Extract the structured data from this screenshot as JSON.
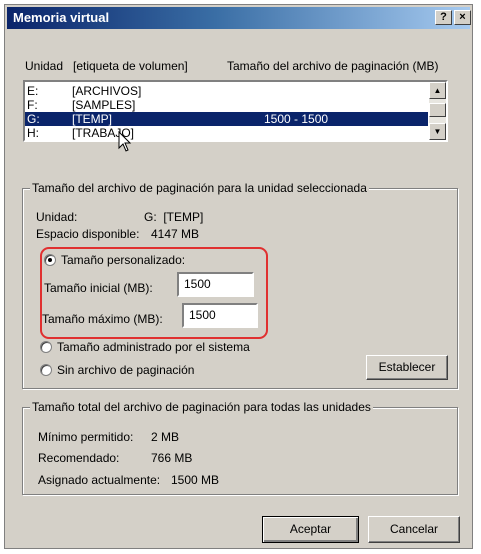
{
  "window": {
    "title": "Memoria virtual",
    "help_button": "?",
    "close_button": "×"
  },
  "drives": {
    "headers": {
      "drive": "Unidad",
      "volume_label": "[etiqueta de volumen]",
      "paging_size": "Tamaño del archivo de paginación (MB)"
    },
    "rows": [
      {
        "drive": "E:",
        "label": "[ARCHIVOS]",
        "size": ""
      },
      {
        "drive": "F:",
        "label": "[SAMPLES]",
        "size": ""
      },
      {
        "drive": "G:",
        "label": "[TEMP]",
        "size": "1500 - 1500",
        "selected": true
      },
      {
        "drive": "H:",
        "label": "[TRABAJO]",
        "size": ""
      }
    ]
  },
  "selected_drive": {
    "group_title": "Tamaño del archivo de paginación para la unidad seleccionada",
    "drive_label": "Unidad:",
    "drive_value": "G:  [TEMP]",
    "space_label": "Espacio disponible:",
    "space_value": "4147 MB",
    "custom_size_label": "Tamaño personalizado:",
    "initial_label": "Tamaño inicial (MB):",
    "initial_value": "1500",
    "max_label": "Tamaño máximo (MB):",
    "max_value": "1500",
    "system_managed_label": "Tamaño administrado por el sistema",
    "no_paging_label": "Sin archivo de paginación",
    "set_button": "Establecer"
  },
  "totals": {
    "group_title": "Tamaño total del archivo de paginación para todas las unidades",
    "min_label": "Mínimo permitido:",
    "min_value": "2 MB",
    "rec_label": "Recomendado:",
    "rec_value": "766 MB",
    "alloc_label": "Asignado actualmente:",
    "alloc_value": "1500 MB"
  },
  "buttons": {
    "ok": "Aceptar",
    "cancel": "Cancelar"
  },
  "colors": {
    "accent": "#0a246a",
    "highlight_outline": "#e03030"
  }
}
